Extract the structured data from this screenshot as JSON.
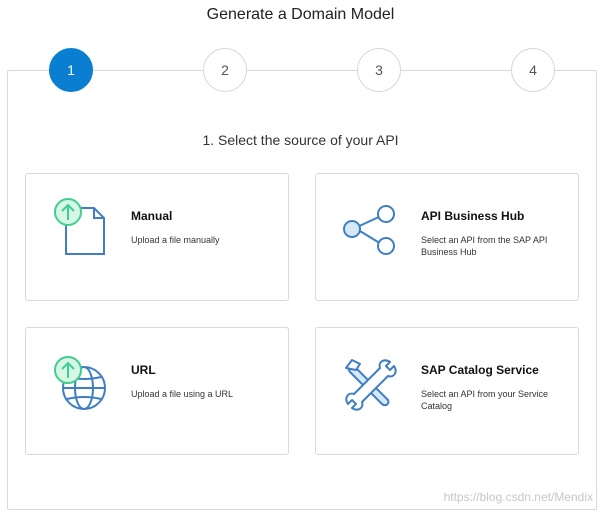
{
  "dialog": {
    "title": "Generate a Domain Model"
  },
  "steps": [
    {
      "label": "1",
      "active": true
    },
    {
      "label": "2",
      "active": false
    },
    {
      "label": "3",
      "active": false
    },
    {
      "label": "4",
      "active": false
    }
  ],
  "section": {
    "heading": "1. Select the source of your API"
  },
  "cards": {
    "manual": {
      "title": "Manual",
      "description": "Upload a file manually",
      "icon": "file-upload-icon"
    },
    "api_hub": {
      "title": "API Business Hub",
      "description": "Select an API from the SAP API Business Hub",
      "icon": "share-nodes-icon"
    },
    "url": {
      "title": "URL",
      "description": "Upload a file using a URL",
      "icon": "globe-upload-icon"
    },
    "catalog": {
      "title": "SAP Catalog Service",
      "description": "Select an API from your Service Catalog",
      "icon": "wrench-screwdriver-icon"
    }
  },
  "watermark": {
    "text": "https://blog.csdn.net/Mendix"
  },
  "colors": {
    "accent": "#0a7fd1",
    "icon_blue": "#3f7ec4",
    "upload_green": "#3ecf8e",
    "upload_green_fill": "#d8f6e6"
  }
}
